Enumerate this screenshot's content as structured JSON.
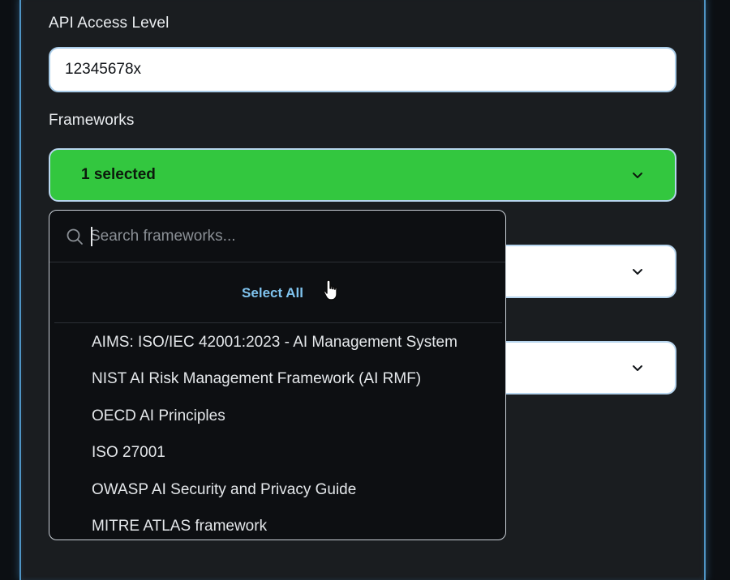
{
  "form": {
    "api_access_label": "API Access Level",
    "api_access_value": "12345678x",
    "frameworks_label": "Frameworks",
    "frameworks_select_value": "1 selected"
  },
  "dropdown": {
    "search_placeholder": "Search frameworks...",
    "select_all_label": "Select All",
    "options": [
      "AIMS: ISO/IEC 42001:2023 - AI Management System",
      "NIST AI Risk Management Framework (AI RMF)",
      "OECD AI Principles",
      "ISO 27001",
      "OWASP AI Security and Privacy Guide",
      "MITRE ATLAS framework"
    ]
  },
  "icons": {
    "chevron": "chevron-down-icon",
    "search": "search-icon",
    "cursor": "hand-pointer-icon"
  },
  "colors": {
    "panel_bg": "#1a1d20",
    "panel_border": "#4f94c4",
    "selected_green": "#33c73f",
    "select_all_blue": "#7fc3ee",
    "dropdown_bg": "#0d0f12"
  }
}
